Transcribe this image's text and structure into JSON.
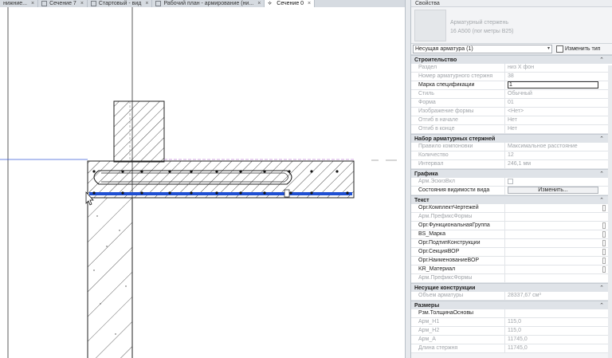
{
  "tabs": [
    {
      "label": "нижние...",
      "active": false
    },
    {
      "label": "Сечение 7",
      "active": false
    },
    {
      "label": "Стартовый - вид",
      "active": false
    },
    {
      "label": "Рабочий план - армирование (ни...",
      "active": false
    },
    {
      "label": "Сечение 0",
      "active": true
    }
  ],
  "tab_close": "×",
  "properties": {
    "title": "Свойства",
    "type_name_line1": "Арматурный стержень",
    "type_name_line2": "16 A500 (пог метры B25)",
    "selector_value": "Несущая арматура (1)",
    "selector_arrow": "▾",
    "edit_type_label": "Изменить тип",
    "groups": [
      {
        "name": "Строительство",
        "rows": [
          {
            "key": "Раздел",
            "value": "низ X фон",
            "enabled": false
          },
          {
            "key": "Номер арматурного стержня",
            "value": "38",
            "enabled": false
          },
          {
            "key": "Марка спецификации",
            "value": "1",
            "enabled": true,
            "editing": true
          },
          {
            "key": "Стиль",
            "value": "Обычный",
            "enabled": false
          },
          {
            "key": "Форма",
            "value": "01",
            "enabled": false
          },
          {
            "key": "Изображение формы",
            "value": "<Нет>",
            "enabled": false
          },
          {
            "key": "Отгиб в начале",
            "value": "Нет",
            "enabled": false
          },
          {
            "key": "Отгиб в конце",
            "value": "Нет",
            "enabled": false
          }
        ]
      },
      {
        "name": "Набор арматурных стержней",
        "rows": [
          {
            "key": "Правило компоновки",
            "value": "Максимальное расстояние",
            "enabled": false
          },
          {
            "key": "Количество",
            "value": "12",
            "enabled": false
          },
          {
            "key": "Интервал",
            "value": "246,1 мм",
            "enabled": false
          }
        ]
      },
      {
        "name": "Графика",
        "rows": [
          {
            "key": "Арм.ЭскизВкл",
            "value": "",
            "enabled": false,
            "checkbox": true
          },
          {
            "key": "Состояния видимости вида",
            "value": "Изменить...",
            "enabled": true,
            "button": true
          }
        ]
      },
      {
        "name": "Текст",
        "rows": [
          {
            "key": "Орг.КомплектЧертежей",
            "value": "",
            "enabled": true
          },
          {
            "key": "Арм.ПрефиксФормы",
            "value": "",
            "enabled": false
          },
          {
            "key": "Орг.ФункциональнаяГруппа",
            "value": "",
            "enabled": true
          },
          {
            "key": "BS_Марка",
            "value": "",
            "enabled": true
          },
          {
            "key": "Орг.ПодтипКонструкции",
            "value": "",
            "enabled": true
          },
          {
            "key": "Орг.СекцияВОР",
            "value": "",
            "enabled": true
          },
          {
            "key": "Орг.НаименованиеВОР",
            "value": "",
            "enabled": true
          },
          {
            "key": "KR_Материал",
            "value": "",
            "enabled": true
          },
          {
            "key": "Арм.ПрефиксФормы",
            "value": "",
            "enabled": false
          }
        ]
      },
      {
        "name": "Несущие конструкции",
        "rows": [
          {
            "key": "Объем арматуры",
            "value": "28337,67 см³",
            "enabled": false
          }
        ]
      },
      {
        "name": "Размеры",
        "rows": [
          {
            "key": "Рзм.ТолщинаОсновы",
            "value": "",
            "enabled": true
          },
          {
            "key": "Арм_Н1",
            "value": "115,0",
            "enabled": false
          },
          {
            "key": "Арм_Н2",
            "value": "115,0",
            "enabled": false
          },
          {
            "key": "Арм_А",
            "value": "11745,0",
            "enabled": false
          },
          {
            "key": "Длина стержня",
            "value": "11745,0",
            "enabled": false
          }
        ]
      }
    ],
    "collapse_glyph": "⌃"
  },
  "colors": {
    "rebar_selected": "#1f4fd1",
    "hatch": "#222222",
    "datum_line": "#3a5bd9"
  }
}
